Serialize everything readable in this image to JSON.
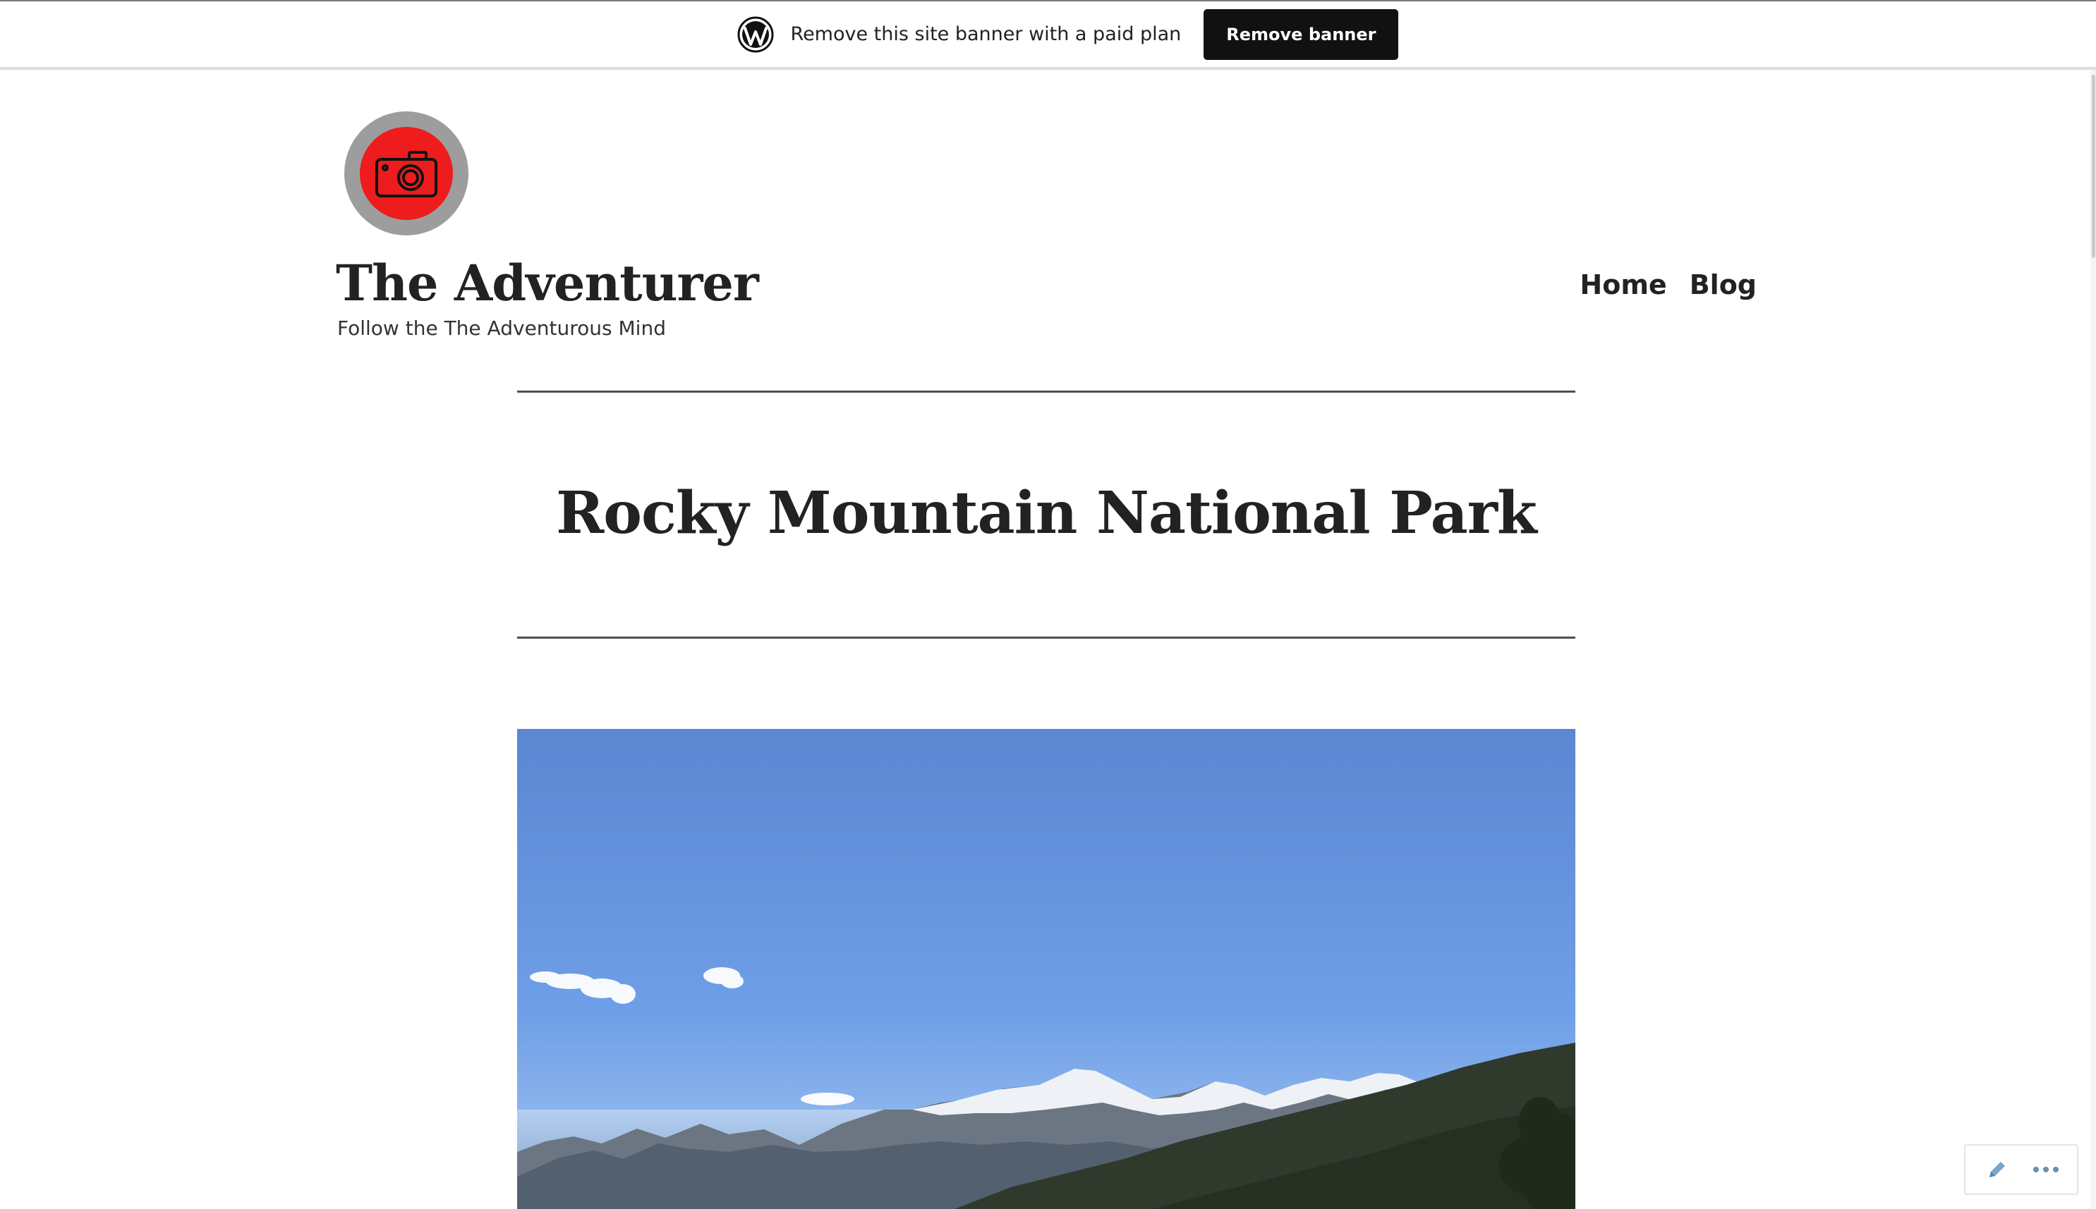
{
  "banner": {
    "text": "Remove this site banner with a paid plan",
    "button_label": "Remove banner"
  },
  "site": {
    "title": "The Adventurer",
    "tagline": "Follow the The Adventurous Mind"
  },
  "nav": {
    "items": [
      {
        "label": "Home"
      },
      {
        "label": "Blog"
      }
    ]
  },
  "post": {
    "title": "Rocky Mountain National Park"
  },
  "icons": {
    "banner_logo": "wordpress-icon",
    "site_logo": "camera-icon",
    "edit": "pencil-icon",
    "more": "ellipsis-icon"
  },
  "colors": {
    "logo_outer": "#9d9d9d",
    "logo_inner": "#ee1c1c",
    "banner_button": "#111111",
    "rule": "#4a5058"
  }
}
